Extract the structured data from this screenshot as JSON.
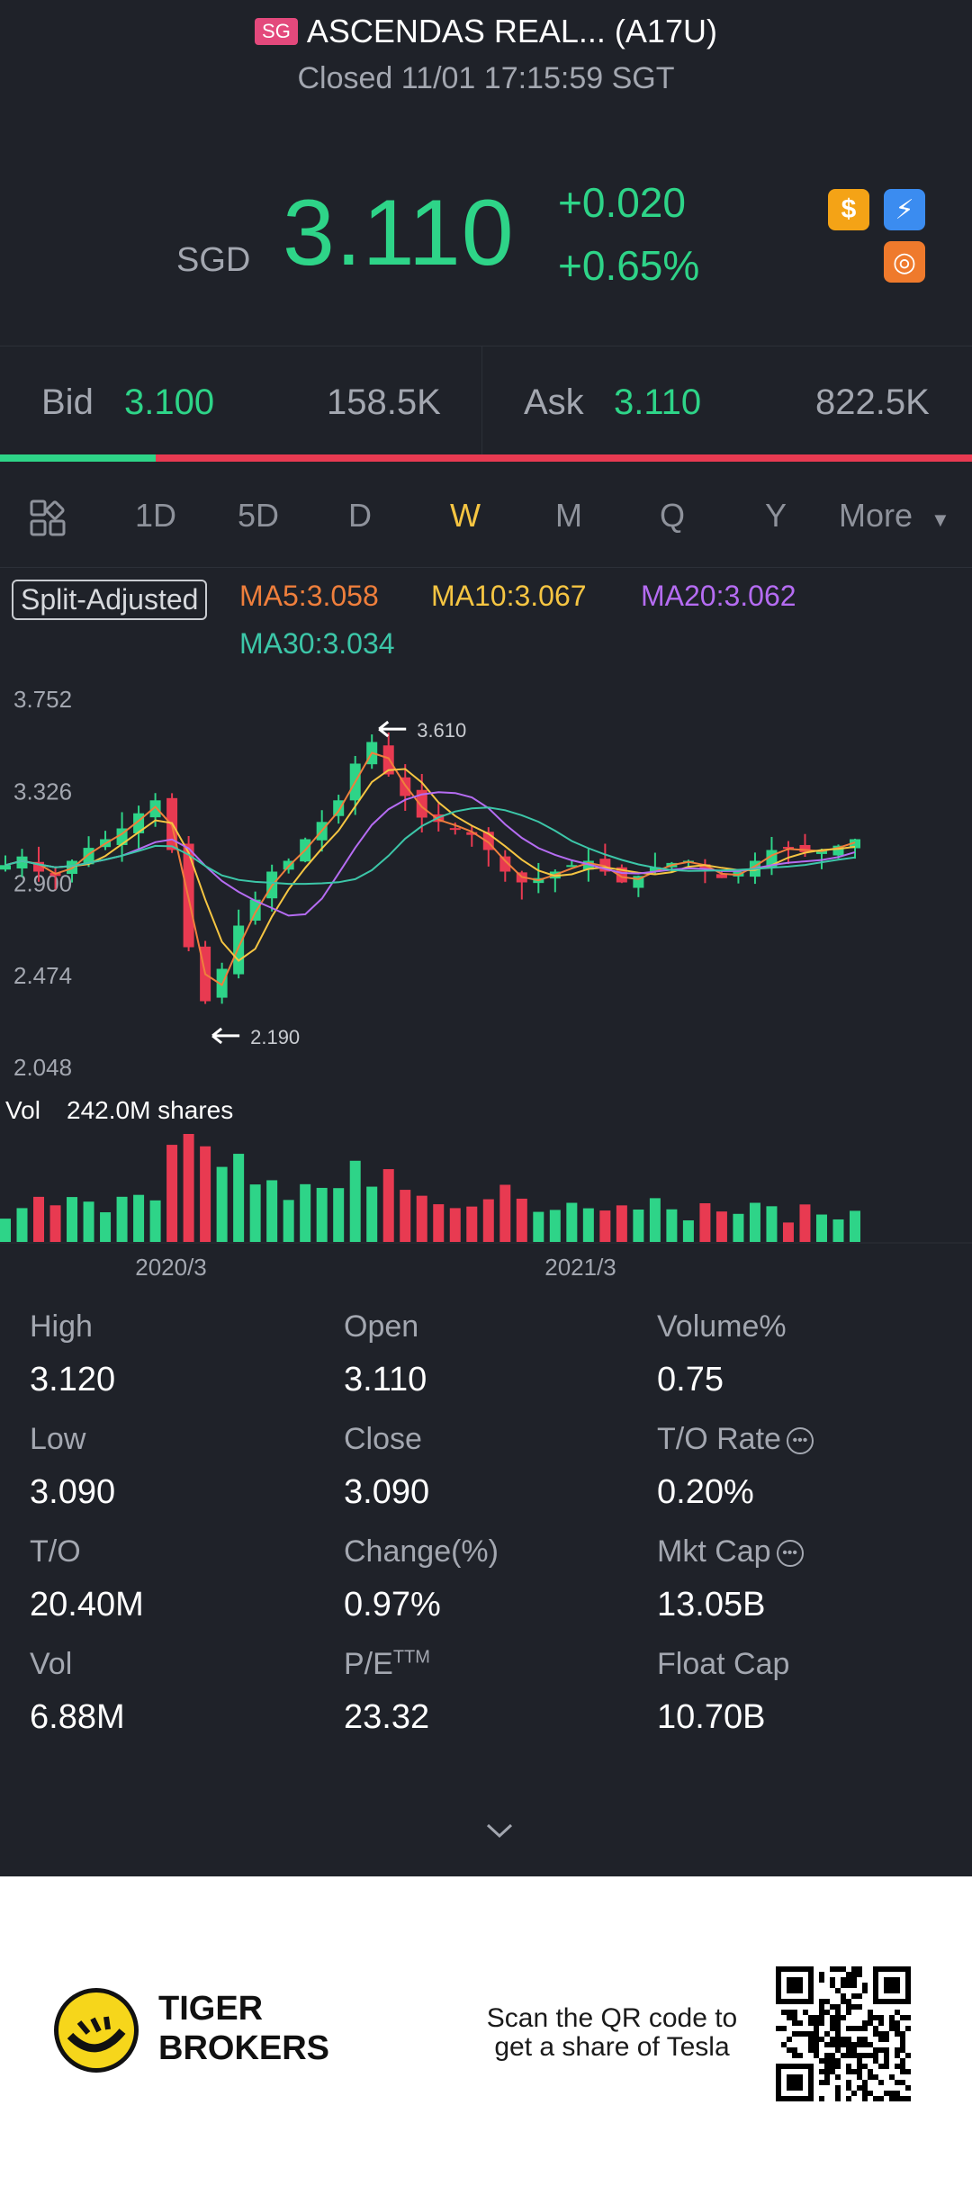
{
  "header": {
    "market_badge": "SG",
    "title": "ASCENDAS REAL... (A17U)",
    "status": "Closed 11/01 17:15:59 SGT"
  },
  "quote": {
    "currency": "SGD",
    "price": "3.110",
    "change": "+0.020",
    "change_pct": "+0.65%"
  },
  "bid_ask": {
    "bid_label": "Bid",
    "bid_price": "3.100",
    "bid_size": "158.5K",
    "ask_label": "Ask",
    "ask_price": "3.110",
    "ask_size": "822.5K",
    "bid_ratio": 0.16
  },
  "tabs": {
    "items": [
      "1D",
      "5D",
      "D",
      "W",
      "M",
      "Q",
      "Y"
    ],
    "active": "W",
    "more_label": "More"
  },
  "indicators": {
    "split_label": "Split-Adjusted",
    "ma5": "MA5:3.058",
    "ma10": "MA10:3.067",
    "ma20": "MA20:3.062",
    "ma30": "MA30:3.034"
  },
  "colors": {
    "up": "#2ed488",
    "down": "#e83a51",
    "ma5": "#ef7f3c",
    "ma10": "#f5c542",
    "ma20": "#b56cf2",
    "ma30": "#3cc6a8",
    "accent_tab": "#f5c542"
  },
  "chart_data": {
    "type": "candlestick",
    "y_ticks": [
      "3.752",
      "3.326",
      "2.900",
      "2.474",
      "2.048"
    ],
    "x_ticks": [
      "2020/3",
      "2021/3"
    ],
    "high_marker": "3.610",
    "low_marker": "2.190",
    "volume_label": "Vol",
    "volume_value": "242.0M shares",
    "close_trend": [
      2.98,
      3.02,
      2.95,
      2.93,
      3.0,
      3.06,
      3.1,
      3.15,
      3.22,
      3.28,
      3.05,
      2.6,
      2.35,
      2.5,
      2.7,
      2.82,
      2.95,
      3.0,
      3.1,
      3.18,
      3.28,
      3.45,
      3.55,
      3.4,
      3.3,
      3.2,
      3.18,
      3.15,
      3.12,
      3.05,
      2.95,
      2.9,
      2.92,
      2.95,
      2.98,
      3.0,
      2.95,
      2.9,
      2.93,
      2.97,
      2.99,
      3.0,
      2.96,
      2.92,
      2.95,
      3.0,
      3.05,
      3.06,
      3.04,
      3.05,
      3.07,
      3.1
    ]
  },
  "stats": [
    {
      "label": "High",
      "value": "3.120"
    },
    {
      "label": "Open",
      "value": "3.110"
    },
    {
      "label": "Volume%",
      "value": "0.75"
    },
    {
      "label": "Low",
      "value": "3.090"
    },
    {
      "label": "Close",
      "value": "3.090"
    },
    {
      "label": "T/O Rate",
      "value": "0.20%"
    },
    {
      "label": "T/O",
      "value": "20.40M"
    },
    {
      "label": "Change(%)",
      "value": "0.97%"
    },
    {
      "label": "Mkt Cap",
      "value": "13.05B"
    },
    {
      "label": "Vol",
      "value": "6.88M"
    },
    {
      "label": "P/E",
      "value": "23.32"
    },
    {
      "label": "Float Cap",
      "value": "10.70B"
    }
  ],
  "pe_superscript": "TTM",
  "footer": {
    "brand_line1": "TIGER",
    "brand_line2": "BROKERS",
    "qr_text_line1": "Scan the QR code to",
    "qr_text_line2": "get a share of Tesla"
  }
}
